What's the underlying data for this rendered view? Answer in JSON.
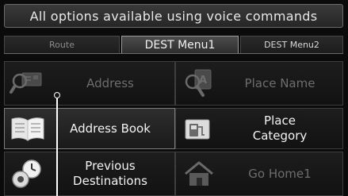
{
  "banner": {
    "text": "All options available using voice commands"
  },
  "tabs": [
    {
      "label": "Route"
    },
    {
      "label": "DEST Menu1"
    },
    {
      "label": "DEST Menu2"
    }
  ],
  "grid": {
    "address": {
      "label": "Address",
      "icon": "address-search-icon"
    },
    "place_name": {
      "label": "Place Name",
      "icon": "place-name-search-icon"
    },
    "address_book": {
      "label": "Address Book",
      "icon": "open-book-icon"
    },
    "place_category": {
      "label": "Place\nCategory",
      "icon": "fuel-pump-icon"
    },
    "previous_destinations": {
      "label": "Previous\nDestinations",
      "icon": "history-clock-icon"
    },
    "go_home": {
      "label": "Go Home1",
      "icon": "house-icon"
    }
  },
  "colors": {
    "background": "#0b0b0b",
    "enabled_text": "#f3f3f3",
    "disabled_text": "#6d6d6d"
  }
}
